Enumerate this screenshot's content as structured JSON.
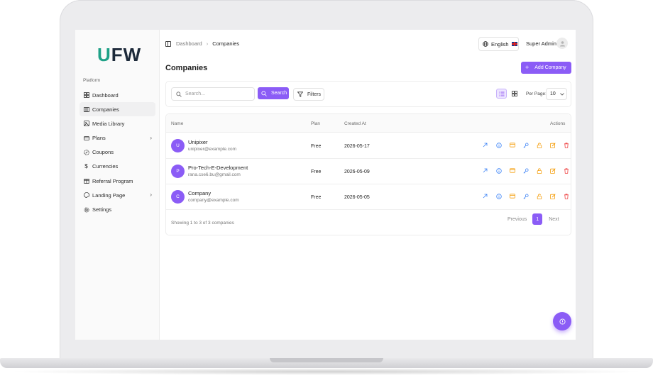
{
  "app": {
    "logo_prefix": "U",
    "logo_suffix": "FW"
  },
  "sidebar": {
    "section_label": "Platform",
    "items": [
      {
        "label": "Dashboard",
        "icon": "grid-icon"
      },
      {
        "label": "Companies",
        "icon": "building-icon",
        "active": true
      },
      {
        "label": "Media Library",
        "icon": "image-icon"
      },
      {
        "label": "Plans",
        "icon": "card-icon",
        "expandable": true
      },
      {
        "label": "Coupons",
        "icon": "badge-icon"
      },
      {
        "label": "Currencies",
        "icon": "dollar-icon"
      },
      {
        "label": "Referral Program",
        "icon": "gift-icon"
      },
      {
        "label": "Landing Page",
        "icon": "palette-icon",
        "expandable": true
      },
      {
        "label": "Settings",
        "icon": "gear-icon"
      }
    ]
  },
  "header": {
    "breadcrumb": [
      "Dashboard",
      "Companies"
    ],
    "language": "English",
    "user": "Super Admin"
  },
  "page": {
    "title": "Companies",
    "add_label": "Add Company"
  },
  "toolbar": {
    "search_placeholder": "Search...",
    "search_label": "Search",
    "filters_label": "Filters",
    "per_page_label": "Per Page:",
    "per_page_value": "10"
  },
  "table": {
    "columns": {
      "name": "Name",
      "plan": "Plan",
      "created": "Created At",
      "actions": "Actions"
    },
    "rows": [
      {
        "initial": "U",
        "name": "Unipixer",
        "email": "unipixer@example.com",
        "plan": "Free",
        "created": "2026-05-17"
      },
      {
        "initial": "P",
        "name": "Pro-Tech-E-Development",
        "email": "rana.cse6.bu@gmail.com",
        "plan": "Free",
        "created": "2026-05-09"
      },
      {
        "initial": "C",
        "name": "Company",
        "email": "company@example.com",
        "plan": "Free",
        "created": "2026-05-05"
      }
    ],
    "summary": "Showing 1 to 3 of 3 companies"
  },
  "pagination": {
    "previous": "Previous",
    "current": "1",
    "next": "Next"
  },
  "colors": {
    "accent": "#8b5cf6",
    "logo_green": "#1fa187",
    "logo_dark": "#1d2a3a"
  }
}
